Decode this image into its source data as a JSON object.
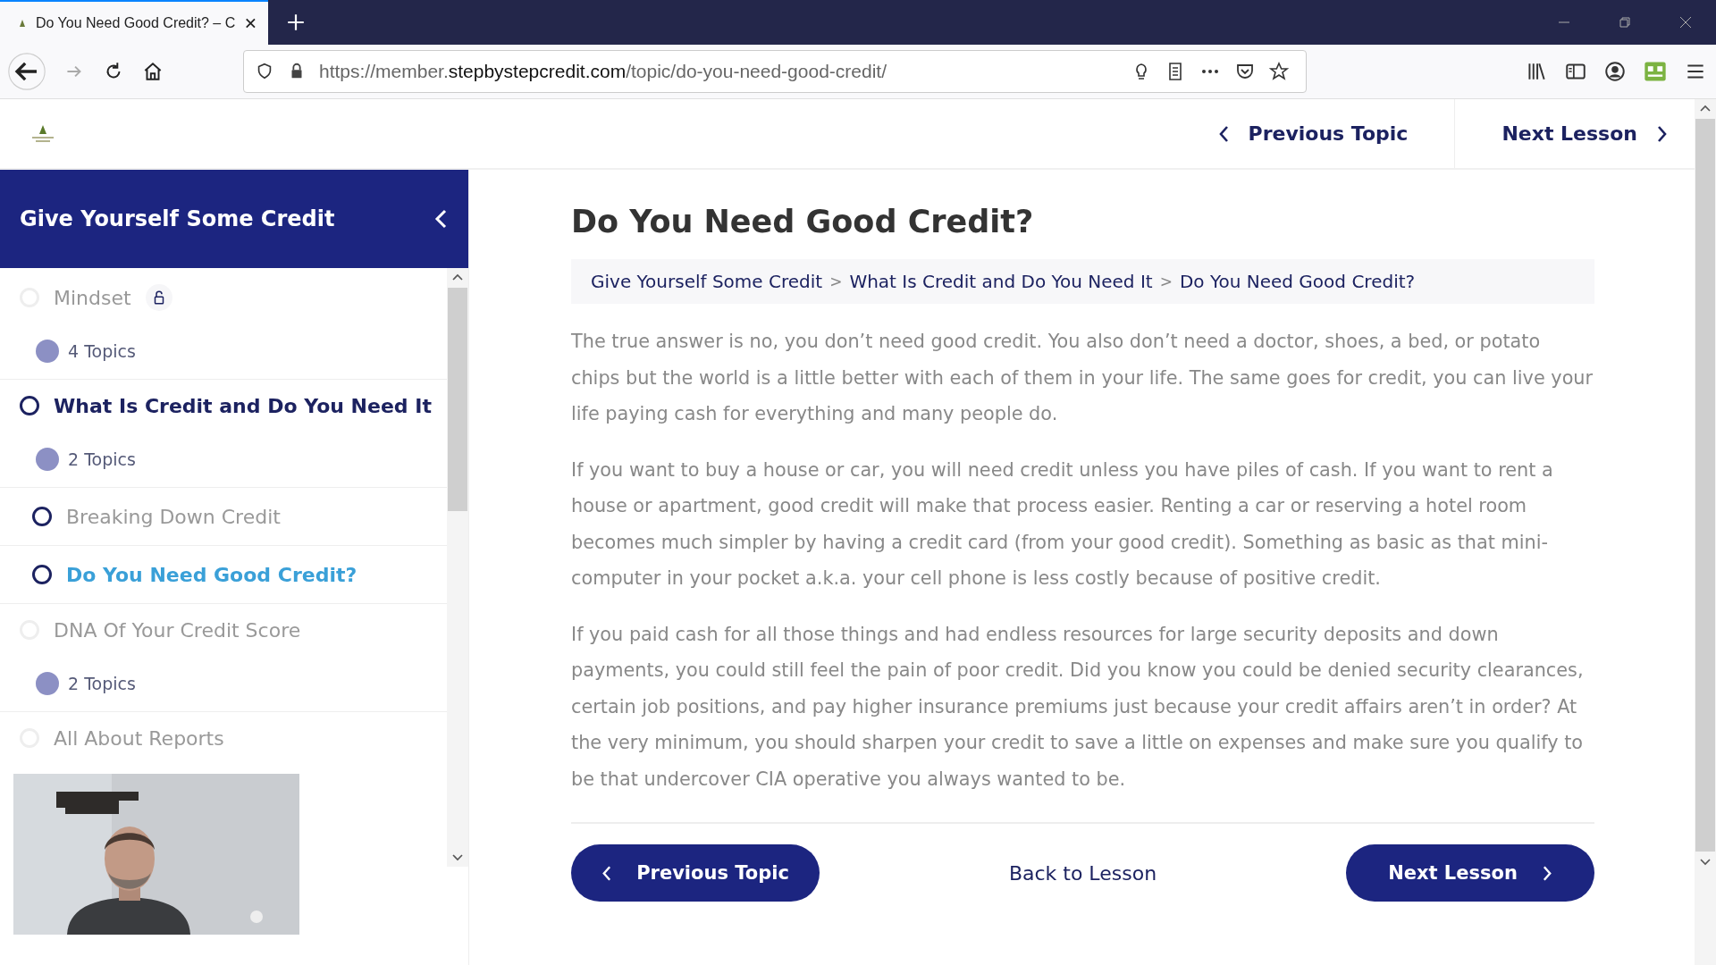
{
  "browser": {
    "tab_title": "Do You Need Good Credit? – C",
    "url_prefix": "https://member.",
    "url_domain": "stepbystepcredit.com",
    "url_path": "/topic/do-you-need-good-credit/"
  },
  "header": {
    "previous": "Previous Topic",
    "next": "Next Lesson"
  },
  "sidebar": {
    "title": "Give Yourself Some Credit",
    "items": [
      {
        "kind": "lesson",
        "title": "Mindset",
        "current": false,
        "locked": true
      },
      {
        "kind": "count",
        "label": "4 Topics"
      },
      {
        "kind": "lesson",
        "title": "What Is Credit and Do You Need It",
        "current": true,
        "locked": false
      },
      {
        "kind": "count",
        "label": "2 Topics"
      },
      {
        "kind": "topic",
        "title": "Breaking Down Credit",
        "selected": false
      },
      {
        "kind": "topic",
        "title": "Do You Need Good Credit?",
        "selected": true
      },
      {
        "kind": "lesson",
        "title": "DNA Of Your Credit Score",
        "current": false,
        "locked": false
      },
      {
        "kind": "count",
        "label": "2 Topics"
      },
      {
        "kind": "lesson",
        "title": "All About Reports",
        "current": false,
        "locked": false
      }
    ]
  },
  "content": {
    "title": "Do You Need Good Credit?",
    "breadcrumbs": [
      "Give Yourself Some Credit",
      "What Is Credit and Do You Need It",
      "Do You Need Good Credit?"
    ],
    "breadcrumb_separator": ">",
    "paragraphs": [
      "The true answer is no, you don’t need good credit. You also don’t need a doctor, shoes, a bed, or potato chips but the world is a little better with each of them in your life. The same goes for credit, you can live your life paying cash for everything and many people do.",
      "If you want to buy a house or car, you will need credit unless you have piles of cash. If you want to rent a house or apartment, good credit will make that process easier. Renting a car or reserving a hotel room becomes much simpler by having a credit card (from your good credit). Something as basic as that mini-computer in your pocket a.k.a. your cell phone is less costly because of positive credit.",
      "If you paid cash for all those things and had endless resources for large security deposits and down payments, you could still feel the pain of poor credit. Did you know you could be denied security clearances, certain job positions, and pay higher insurance premiums just because your credit affairs aren’t in order? At the very minimum, you should sharpen your credit to save a little on expenses and make sure you qualify to be that undercover CIA operative you always wanted to be."
    ],
    "previous": "Previous Topic",
    "back": "Back to Lesson",
    "next": "Next Lesson"
  }
}
